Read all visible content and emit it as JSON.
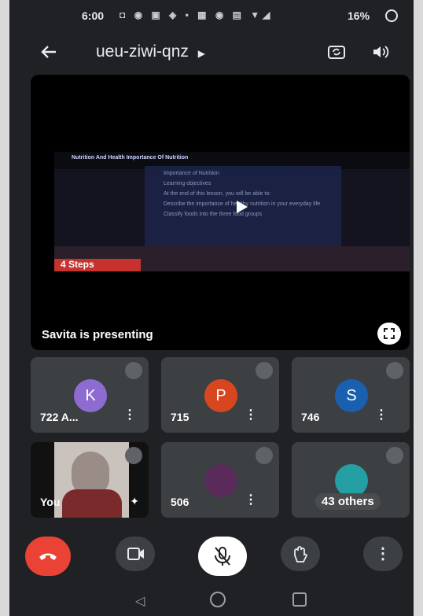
{
  "status_bar": {
    "time": "6:00",
    "battery": "16%"
  },
  "meeting": {
    "code": "ueu-ziwi-qnz",
    "presenter_label": "Savita is presenting",
    "slide": {
      "title": "Nutrition And Health Importance Of Nutrition",
      "lines": [
        "Importance of Nutrition",
        "Learning objectives",
        "At the end of this lesson, you will be able to:",
        "Describe the importance of healthy nutrition in your everyday life",
        "Classify foods into the three food groups"
      ],
      "banner": "4 Steps"
    }
  },
  "participants": [
    {
      "initial": "K",
      "name": "722 A...",
      "color": "#8e6bd1"
    },
    {
      "initial": "P",
      "name": "715",
      "color": "#d7461f"
    },
    {
      "initial": "S",
      "name": "746",
      "color": "#1b5fb0"
    },
    {
      "initial": "",
      "name": "You"
    },
    {
      "initial": "",
      "name": "506"
    },
    {
      "initial": "",
      "name": "43 others"
    }
  ],
  "controls": {
    "end_call_color": "#ea4335"
  }
}
